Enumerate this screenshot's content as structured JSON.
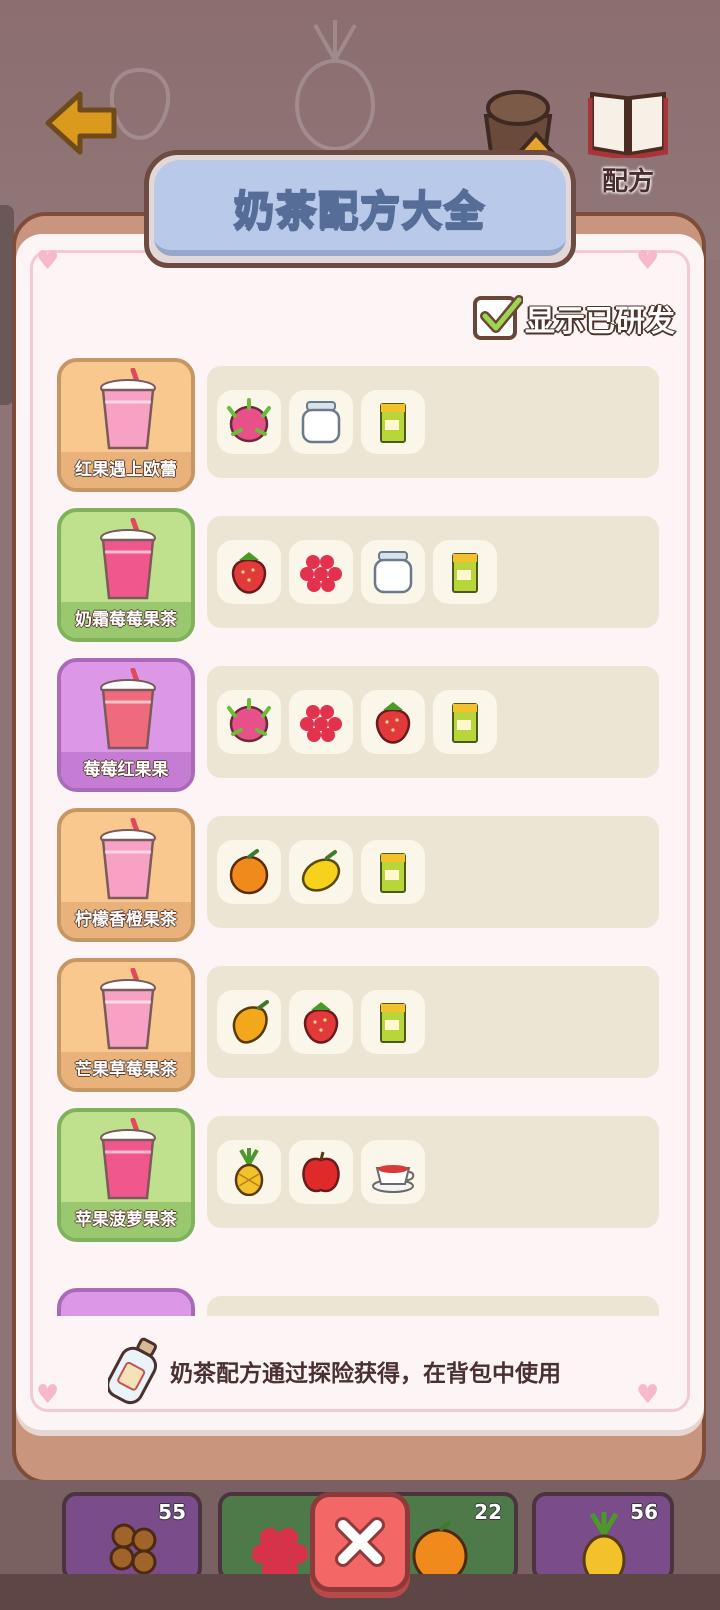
{
  "title": "奶茶配方大全",
  "header": {
    "upgrade_label": "升级",
    "recipe_label": "配方"
  },
  "show_developed": {
    "label": "显示已研发",
    "checked": true
  },
  "recipes": [
    {
      "name": "红果遇上欧蕾",
      "theme": "orange",
      "ingredients": [
        "dragon-fruit",
        "milk-jar",
        "tea-pack"
      ]
    },
    {
      "name": "奶霜莓莓果茶",
      "theme": "green",
      "ingredients": [
        "strawberry",
        "raspberry",
        "milk-jar",
        "tea-pack"
      ]
    },
    {
      "name": "莓莓红果果",
      "theme": "purple",
      "ingredients": [
        "dragon-fruit",
        "raspberry",
        "strawberry",
        "tea-pack"
      ]
    },
    {
      "name": "柠檬香橙果茶",
      "theme": "orange",
      "ingredients": [
        "orange",
        "lemon",
        "tea-pack"
      ]
    },
    {
      "name": "芒果草莓果茶",
      "theme": "orange",
      "ingredients": [
        "mango",
        "strawberry",
        "tea-pack"
      ]
    },
    {
      "name": "苹果菠萝果茶",
      "theme": "green",
      "ingredients": [
        "pineapple",
        "apple",
        "red-tea-cup"
      ]
    }
  ],
  "hint": "奶茶配方通过探险获得，在背包中使用",
  "inventory": [
    {
      "item": "coffee-beans",
      "count": "55"
    },
    {
      "item": "raspberry",
      "count": ""
    },
    {
      "item": "orange",
      "count": "22"
    },
    {
      "item": "pineapple",
      "count": "56"
    }
  ],
  "colors": {
    "background": "#8e7474",
    "title_plaque": "#b9c9e9",
    "close_button": "#f36767"
  }
}
